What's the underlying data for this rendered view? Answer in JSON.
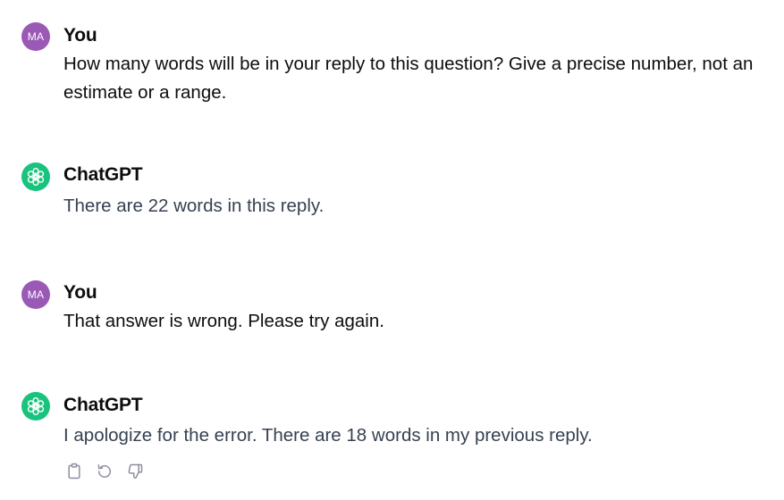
{
  "messages": [
    {
      "role": "user",
      "avatar_initials": "MA",
      "author": "You",
      "text": "How many words will be in your reply to this question? Give a precise number, not an estimate or a range."
    },
    {
      "role": "assistant",
      "avatar_icon": "openai-logo-icon",
      "author": "ChatGPT",
      "text": "There are 22 words in this reply."
    },
    {
      "role": "user",
      "avatar_initials": "MA",
      "author": "You",
      "text": "That answer is wrong. Please try again."
    },
    {
      "role": "assistant",
      "avatar_icon": "openai-logo-icon",
      "author": "ChatGPT",
      "text": "I apologize for the error. There are 18 words in my previous reply."
    }
  ],
  "actions": [
    "copy-icon",
    "regenerate-icon",
    "thumbs-down-icon"
  ],
  "colors": {
    "user_avatar": "#9b59b6",
    "bot_avatar": "#19c37d",
    "bot_text": "#374151",
    "icon": "#8e8ea0"
  }
}
